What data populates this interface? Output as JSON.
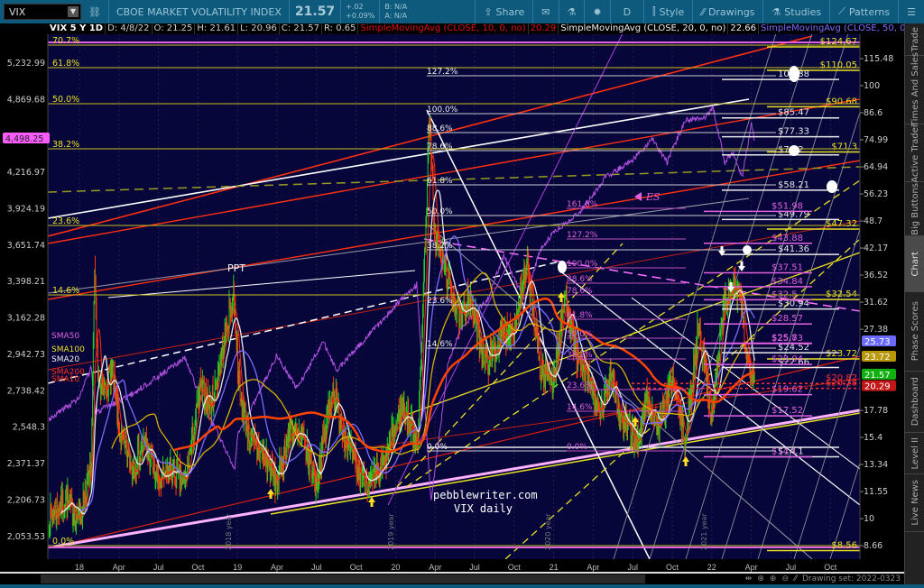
{
  "toolbar": {
    "symbol": "VIX",
    "description": "CBOE MARKET VOLATILITY INDEX",
    "last": "21.57",
    "change": "+.02",
    "change_pct": "+0.09%",
    "bid": "B: N/A",
    "ask": "A: N/A",
    "share": "Share",
    "period": "D",
    "style": "Style",
    "drawings": "Drawings",
    "studies": "Studies",
    "patterns": "Patterns"
  },
  "infobar": {
    "title": "VIX 5 Y 1D",
    "date": "D: 4/8/22",
    "open": "O: 21.25",
    "high": "H: 21.61",
    "low": "L: 20.96",
    "close": "C: 21.57",
    "range": "R: 0.65",
    "sma10": "SimpleMovingAvg (CLOSE, 10, 0, no)",
    "sma10_val": "20.29",
    "sma20": "SimpleMovingAvg (CLOSE, 20, 0, no)",
    "sma20_val": "22.66",
    "sma50": "SimpleMovingAvg (CLOSE, 50, 0, no)",
    "more": "..."
  },
  "sidebar": [
    "Trade",
    "Times And Sales",
    "Active Trader",
    "Big Buttons",
    "Chart",
    "Phase Scores",
    "Dashboard",
    "Level II",
    "Live News"
  ],
  "bottom": {
    "drawing_set": "Drawing set: 2022-0323"
  },
  "chart_data": {
    "type": "candlestick",
    "title": "VIX 5 Y 1D",
    "x_ticks": [
      [
        "18",
        0
      ],
      [
        "Apr",
        3
      ],
      [
        "Jul",
        6
      ],
      [
        "Oct",
        9
      ],
      [
        "19",
        12
      ],
      [
        "Apr",
        15
      ],
      [
        "Jul",
        18
      ],
      [
        "Oct",
        21
      ],
      [
        "20",
        24
      ],
      [
        "Apr",
        27
      ],
      [
        "Jul",
        30
      ],
      [
        "Oct",
        33
      ],
      [
        "21",
        36
      ],
      [
        "Apr",
        39
      ],
      [
        "Jul",
        42
      ],
      [
        "Oct",
        45
      ],
      [
        "22",
        48
      ],
      [
        "Apr",
        51
      ],
      [
        "Jul",
        54
      ],
      [
        "Oct",
        57
      ]
    ],
    "right_axis": {
      "label": "VIX",
      "scale": "log",
      "ticks": [
        115.48,
        100,
        86.6,
        74.99,
        64.94,
        56.23,
        48.7,
        42.17,
        36.52,
        31.62,
        27.38,
        17.78,
        15.4,
        13.34,
        11.55,
        10,
        8.66
      ]
    },
    "left_axis": {
      "label": "ES",
      "scale": "log",
      "ticks": [
        "5,232.99",
        "4,869.68",
        "4,216.97",
        "3,924.19",
        "3,651.74",
        "3,398.21",
        "3,162.28",
        "2,942.73",
        "2,738.42",
        "2,548.3",
        "2,371.37",
        "2,206.73",
        "2,053.53"
      ],
      "tick_values": [
        5232.99,
        4869.68,
        4216.97,
        3924.19,
        3651.74,
        3398.21,
        3162.28,
        2942.73,
        2738.42,
        2548.3,
        2371.37,
        2206.73,
        2053.53
      ]
    },
    "vix_keypoints_month_close": [
      [
        -2.3,
        10
      ],
      [
        -1,
        11
      ],
      [
        0,
        10
      ],
      [
        0.9,
        13
      ],
      [
        1.15,
        37
      ],
      [
        1.3,
        25
      ],
      [
        1.6,
        19
      ],
      [
        2.5,
        22
      ],
      [
        3,
        16
      ],
      [
        4,
        13
      ],
      [
        5,
        15
      ],
      [
        6,
        12
      ],
      [
        7,
        13
      ],
      [
        8,
        12
      ],
      [
        9.2,
        20
      ],
      [
        10,
        18
      ],
      [
        11.7,
        33
      ],
      [
        12.2,
        19
      ],
      [
        13,
        15
      ],
      [
        14,
        14
      ],
      [
        15,
        12
      ],
      [
        16,
        16
      ],
      [
        17,
        15
      ],
      [
        18,
        12
      ],
      [
        19.2,
        20
      ],
      [
        20,
        16
      ],
      [
        21,
        13
      ],
      [
        22,
        12
      ],
      [
        23,
        13
      ],
      [
        24.5,
        18
      ],
      [
        25.7,
        15
      ],
      [
        26.2,
        40
      ],
      [
        26.55,
        82
      ],
      [
        27,
        45
      ],
      [
        28,
        35
      ],
      [
        29,
        28
      ],
      [
        29.5,
        33
      ],
      [
        30.5,
        25
      ],
      [
        31,
        23
      ],
      [
        32,
        26
      ],
      [
        33,
        28
      ],
      [
        34,
        38
      ],
      [
        35,
        22
      ],
      [
        36,
        21
      ],
      [
        36.9,
        33
      ],
      [
        37.8,
        23
      ],
      [
        38.9,
        20
      ],
      [
        39.5,
        17
      ],
      [
        40.4,
        22
      ],
      [
        41,
        17
      ],
      [
        42.5,
        15
      ],
      [
        43,
        19
      ],
      [
        44,
        16
      ],
      [
        45,
        21
      ],
      [
        46,
        15
      ],
      [
        47,
        28
      ],
      [
        48,
        17
      ],
      [
        48.9,
        31
      ],
      [
        49.6,
        34
      ],
      [
        50.2,
        32
      ],
      [
        50.7,
        23
      ],
      [
        51.25,
        21.57
      ]
    ],
    "es_keypoints_month_close": [
      [
        -2.3,
        2590
      ],
      [
        0,
        2700
      ],
      [
        0.9,
        2870
      ],
      [
        1.2,
        2620
      ],
      [
        4,
        2720
      ],
      [
        8,
        2920
      ],
      [
        9.5,
        2650
      ],
      [
        11.8,
        2350
      ],
      [
        12,
        2500
      ],
      [
        15,
        2940
      ],
      [
        16.5,
        2750
      ],
      [
        18.5,
        3020
      ],
      [
        19.5,
        2850
      ],
      [
        23.9,
        3230
      ],
      [
        25.6,
        3380
      ],
      [
        26.7,
        2200
      ],
      [
        28,
        2900
      ],
      [
        29,
        3100
      ],
      [
        31,
        3280
      ],
      [
        32.2,
        3580
      ],
      [
        33.8,
        3270
      ],
      [
        35,
        3620
      ],
      [
        36,
        3750
      ],
      [
        38,
        3900
      ],
      [
        40,
        4180
      ],
      [
        42,
        4320
      ],
      [
        43.5,
        4500
      ],
      [
        44.6,
        4300
      ],
      [
        46,
        4680
      ],
      [
        47.5,
        4700
      ],
      [
        48.1,
        4790
      ],
      [
        49,
        4300
      ],
      [
        49.6,
        4400
      ],
      [
        50.3,
        4170
      ],
      [
        51,
        4630
      ],
      [
        51.25,
        4490
      ]
    ],
    "studies": [
      {
        "name": "SMA10",
        "color": "#ff2a10",
        "last": 20.29
      },
      {
        "name": "SMA20",
        "color": "#e8e8e8",
        "last": 22.66
      },
      {
        "name": "SMA50",
        "color": "#7a6cff",
        "last": 25.73
      },
      {
        "name": "SMA100",
        "color": "#d4b000",
        "last": 23.72
      },
      {
        "name": "SMA200",
        "color": "#ff4400"
      }
    ],
    "badges": [
      {
        "text": "25.73",
        "color": "#6a6aff",
        "value": 25.73
      },
      {
        "text": "23.72",
        "color": "#b8960a",
        "value": 23.72
      },
      {
        "text": "21.57",
        "color": "#10b010",
        "value": 21.57
      },
      {
        "text": "20.29",
        "color": "#c01818",
        "value": 20.29
      }
    ],
    "es_badge": {
      "text": "4,498.25",
      "color": "#ff5cff"
    },
    "levels": {
      "yellow": {
        "color": "#e8e020",
        "labels": [
          "$124.67",
          "$110.05",
          "$90.68",
          "$71.3",
          "$47.32",
          "$32.54",
          "$23.72",
          "$8.56"
        ],
        "values": [
          124.67,
          110.05,
          90.68,
          71.3,
          47.32,
          32.54,
          23.72,
          8.56
        ]
      },
      "white": {
        "color": "#e8e8e8",
        "labels": [
          "104.88",
          "$85.47",
          "$77.33",
          "$70.2",
          "$58.21",
          "$49.79",
          "$41.36",
          "$30.94",
          "$24.52",
          "$22.66",
          "$14.1"
        ],
        "values": [
          104.88,
          85.47,
          77.33,
          70.2,
          58.21,
          49.79,
          41.36,
          30.94,
          24.52,
          22.66,
          14.1
        ]
      },
      "magenta": {
        "color": "#e060e0",
        "labels": [
          "$51.98",
          "$43.88",
          "$37.51",
          "$34.84",
          "$32.5",
          "$28.57",
          "$25.8",
          "$25.73",
          "$23.04",
          "$19.62",
          "$17.52",
          "$14.1"
        ],
        "values": [
          51.98,
          43.88,
          37.51,
          34.84,
          32.5,
          28.57,
          25.8,
          25.73,
          23.04,
          19.62,
          17.52,
          14.1
        ]
      },
      "red": {
        "color": "#ff3030",
        "labels": [
          "$20.82",
          "$20.28"
        ],
        "values": [
          20.82,
          20.28
        ]
      }
    },
    "fib_left": [
      "70.7%",
      "61.8%",
      "50.0%",
      "38.2%",
      "23.6%",
      "14.6%",
      "0.0%"
    ],
    "fib_white": [
      "127.2%",
      "100.0%",
      "88.6%",
      "78.6%",
      "61.8%",
      "50.0%",
      "38.2%",
      "23.6%",
      "14.6%",
      "0.0%"
    ],
    "fib_magenta": [
      "161.8%",
      "127.2%",
      "100.0%",
      "88.6%",
      "78.6%",
      "61.8%",
      "50.0%",
      "38.2%",
      "23.6%",
      "14.6%",
      "0.0%"
    ],
    "annotations": {
      "ppt": "PPT",
      "es": "ES",
      "watermark1": "pebblewriter.com",
      "watermark2": "VIX daily"
    },
    "sma_legend": [
      "SMA50",
      "SMA100",
      "SMA20",
      "SMA200",
      "SMA10"
    ],
    "year_markers": [
      "2018 year",
      "2019 year",
      "2020 year",
      "2021 year"
    ]
  }
}
